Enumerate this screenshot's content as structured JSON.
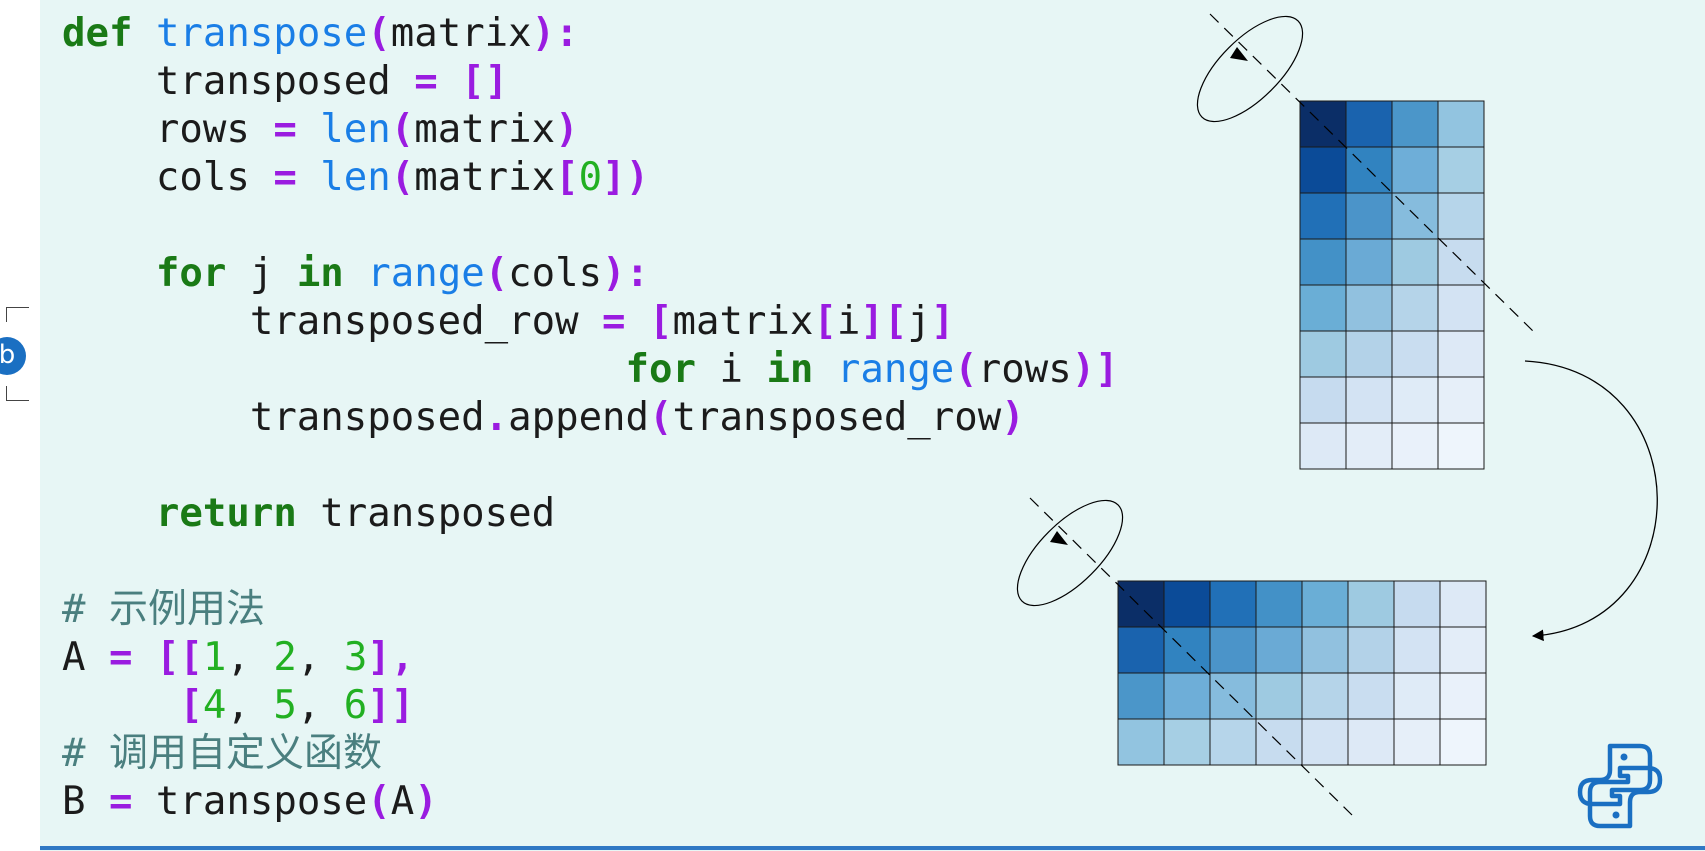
{
  "badge_label": "b",
  "code_tokens": [
    [
      [
        "def",
        "kw"
      ],
      [
        " ",
        ""
      ],
      [
        "transpose",
        "fn"
      ],
      [
        "(",
        "op"
      ],
      [
        "matrix",
        ""
      ],
      [
        ")",
        "op"
      ],
      [
        ":",
        "op"
      ]
    ],
    [
      [
        "    transposed ",
        ""
      ],
      [
        "=",
        "op"
      ],
      [
        " ",
        ""
      ],
      [
        "[]",
        "op"
      ]
    ],
    [
      [
        "    rows ",
        ""
      ],
      [
        "=",
        "op"
      ],
      [
        " ",
        ""
      ],
      [
        "len",
        "fn"
      ],
      [
        "(",
        "op"
      ],
      [
        "matrix",
        ""
      ],
      [
        ")",
        "op"
      ]
    ],
    [
      [
        "    cols ",
        ""
      ],
      [
        "=",
        "op"
      ],
      [
        " ",
        ""
      ],
      [
        "len",
        "fn"
      ],
      [
        "(",
        "op"
      ],
      [
        "matrix",
        ""
      ],
      [
        "[",
        "op"
      ],
      [
        "0",
        "num"
      ],
      [
        "])",
        "op"
      ]
    ],
    [],
    [
      [
        "    ",
        ""
      ],
      [
        "for",
        "kw"
      ],
      [
        " j ",
        ""
      ],
      [
        "in",
        "kw"
      ],
      [
        " ",
        ""
      ],
      [
        "range",
        "fn"
      ],
      [
        "(",
        "op"
      ],
      [
        "cols",
        ""
      ],
      [
        "):",
        "op"
      ]
    ],
    [
      [
        "        transposed_row ",
        ""
      ],
      [
        "=",
        "op"
      ],
      [
        " ",
        ""
      ],
      [
        "[",
        "op"
      ],
      [
        "matrix",
        ""
      ],
      [
        "[",
        "op"
      ],
      [
        "i",
        ""
      ],
      [
        "][",
        "op"
      ],
      [
        "j",
        ""
      ],
      [
        "]",
        "op"
      ]
    ],
    [
      [
        "                        ",
        ""
      ],
      [
        "for",
        "kw"
      ],
      [
        " i ",
        ""
      ],
      [
        "in",
        "kw"
      ],
      [
        " ",
        ""
      ],
      [
        "range",
        "fn"
      ],
      [
        "(",
        "op"
      ],
      [
        "rows",
        ""
      ],
      [
        ")]",
        "op"
      ]
    ],
    [
      [
        "        transposed",
        ""
      ],
      [
        ".",
        "op"
      ],
      [
        "append",
        ""
      ],
      [
        "(",
        "op"
      ],
      [
        "transposed_row",
        ""
      ],
      [
        ")",
        "op"
      ]
    ],
    [],
    [
      [
        "    ",
        ""
      ],
      [
        "return",
        "kw"
      ],
      [
        " transposed",
        ""
      ]
    ],
    [],
    [
      [
        "# 示例用法",
        "cm"
      ]
    ],
    [
      [
        "A ",
        ""
      ],
      [
        "=",
        "op"
      ],
      [
        " ",
        ""
      ],
      [
        "[[",
        "op"
      ],
      [
        "1",
        "num"
      ],
      [
        ", ",
        ""
      ],
      [
        "2",
        "num"
      ],
      [
        ", ",
        ""
      ],
      [
        "3",
        "num"
      ],
      [
        "],",
        "op"
      ]
    ],
    [
      [
        "     ",
        ""
      ],
      [
        "[",
        "op"
      ],
      [
        "4",
        "num"
      ],
      [
        ", ",
        ""
      ],
      [
        "5",
        "num"
      ],
      [
        ", ",
        ""
      ],
      [
        "6",
        "num"
      ],
      [
        "]]",
        "op"
      ]
    ],
    [
      [
        "# 调用自定义函数",
        "cm"
      ]
    ],
    [
      [
        "B ",
        ""
      ],
      [
        "=",
        "op"
      ],
      [
        " transpose",
        ""
      ],
      [
        "(",
        "op"
      ],
      [
        "A",
        ""
      ],
      [
        ")",
        "op"
      ]
    ]
  ],
  "matrix_before": {
    "rows": 8,
    "cols": 4,
    "cell_colors": [
      [
        "#0b2e67",
        "#1a63ae",
        "#4b96c9",
        "#92c4e0"
      ],
      [
        "#0b4b98",
        "#3183c0",
        "#6eaed8",
        "#a6cfe4"
      ],
      [
        "#2170b7",
        "#4b94c9",
        "#86bcdd",
        "#b6d5ea"
      ],
      [
        "#4391c7",
        "#6aaad5",
        "#9ecae1",
        "#c7dcef"
      ],
      [
        "#6aaed6",
        "#91c1df",
        "#b5d4e9",
        "#d3e3f3"
      ],
      [
        "#9ecae1",
        "#b3d2e8",
        "#c9ddf0",
        "#dde9f6"
      ],
      [
        "#c6dbef",
        "#d3e3f3",
        "#dfebf7",
        "#e6eff9"
      ],
      [
        "#dde9f6",
        "#e3edf8",
        "#e9f1fa",
        "#eef5fc"
      ]
    ]
  },
  "matrix_after": {
    "rows": 4,
    "cols": 8,
    "cell_colors": [
      [
        "#0b2e67",
        "#0b4b98",
        "#2170b7",
        "#4391c7",
        "#6aaed6",
        "#9ecae1",
        "#c6dbef",
        "#dde9f6"
      ],
      [
        "#1a63ae",
        "#3183c0",
        "#4b94c9",
        "#6aaad5",
        "#91c1df",
        "#b3d2e8",
        "#d3e3f3",
        "#e3edf8"
      ],
      [
        "#4b96c9",
        "#6eaed8",
        "#86bcdd",
        "#9ecae1",
        "#b5d4e9",
        "#c9ddf0",
        "#dfebf7",
        "#e9f1fa"
      ],
      [
        "#92c4e0",
        "#a6cfe4",
        "#b6d5ea",
        "#c7dcef",
        "#d3e3f3",
        "#dde9f6",
        "#e6eff9",
        "#eef5fc"
      ]
    ]
  },
  "colors": {
    "panel_bg": "#e7f6f5",
    "rule": "#2f78c4",
    "keyword": "#1a7a16",
    "builtin": "#1a7ee6",
    "operator": "#9a1ce0",
    "number": "#22b022",
    "comment": "#4a7f7f",
    "python_logo": "#1a6fc2"
  },
  "icons": [
    "rotate-arrow-icon",
    "curved-arrow-icon",
    "python-logo-icon"
  ]
}
